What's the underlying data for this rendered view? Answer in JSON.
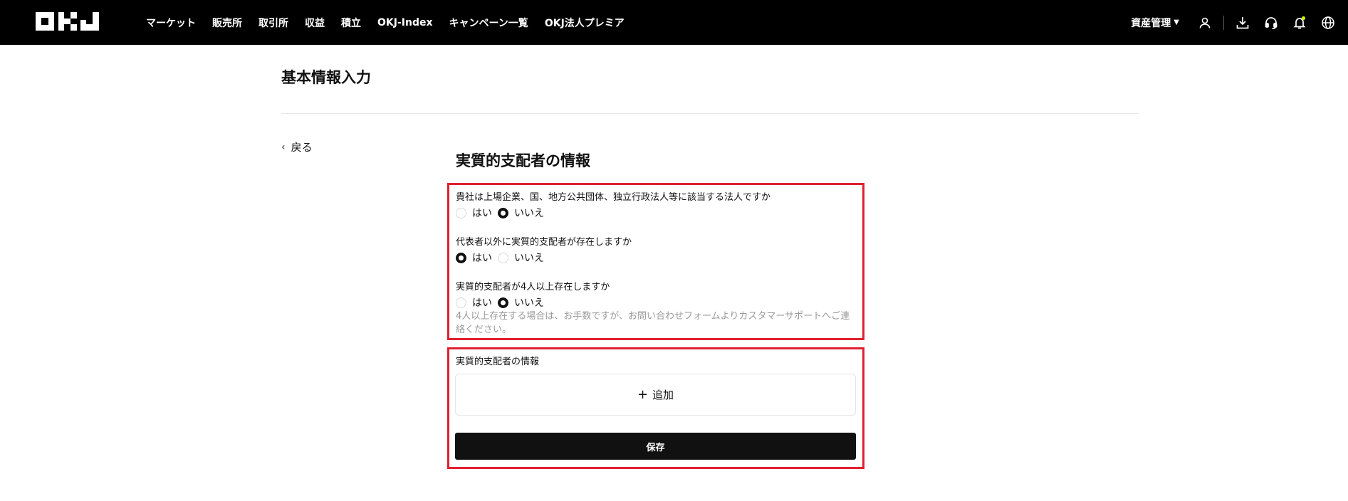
{
  "header": {
    "logo_text": "OKJ",
    "nav": [
      "マーケット",
      "販売所",
      "取引所",
      "収益",
      "積立",
      "OKJ-Index",
      "キャンペーン一覧",
      "OKJ法人プレミア"
    ],
    "asset_label": "資産管理",
    "icons": [
      "user-icon",
      "download-icon",
      "headset-icon",
      "bell-icon",
      "globe-icon"
    ]
  },
  "page": {
    "title": "基本情報入力",
    "back_label": "戻る"
  },
  "form": {
    "section_title": "実質的支配者の情報",
    "questions": [
      {
        "label": "貴社は上場企業、国、地方公共団体、独立行政法人等に該当する法人ですか",
        "options": [
          "はい",
          "いいえ"
        ],
        "selected": "いいえ"
      },
      {
        "label": "代表者以外に実質的支配者が存在しますか",
        "options": [
          "はい",
          "いいえ"
        ],
        "selected": "はい"
      },
      {
        "label": "実質的支配者が4人以上存在しますか",
        "options": [
          "はい",
          "いいえ"
        ],
        "selected": "いいえ"
      }
    ],
    "note": "4人以上存在する場合は、お手数ですが、お問い合わせフォームよりカスタマーサポートへご連絡ください。",
    "owners_label": "実質的支配者の情報",
    "add_label": "追加",
    "save_label": "保存"
  },
  "colors": {
    "header_bg": "#000000",
    "highlight_border": "#e02030",
    "button_bg": "#111111",
    "bell_badge": "#c8f000"
  }
}
